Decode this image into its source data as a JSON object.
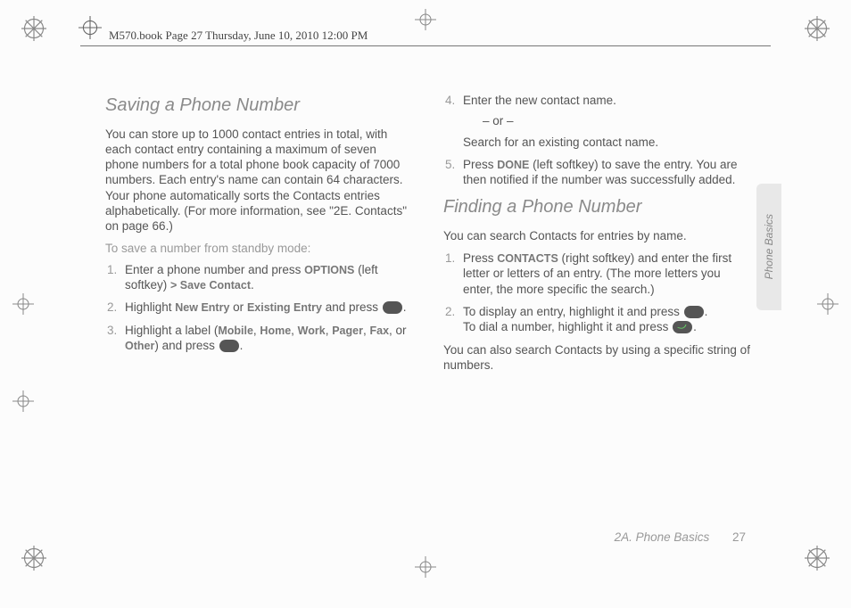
{
  "header": {
    "stamp": "M570.book  Page 27  Thursday, June 10, 2010  12:00 PM"
  },
  "sideTab": "Phone Basics",
  "footer": {
    "section": "2A. Phone Basics",
    "page": "27"
  },
  "s1": {
    "title": "Saving a Phone Number",
    "intro": "You can store up to 1000 contact entries in total, with each contact entry containing a maximum of seven phone numbers for a total phone book capacity of 7000 numbers. Each entry's name can contain 64 characters. Your phone automatically sorts the Contacts entries alphabetically. (For more information, see \"2E. Contacts\" on page 66.)",
    "sub": "To save a number from standby mode:",
    "step1a": "Enter a phone number and press ",
    "step1_opt": "OPTIONS",
    "step1b": " (left softkey) ",
    "gt": ">",
    "step1_save": " Save Contact",
    "step2a": "Highlight ",
    "step2_new": "New Entry",
    "step2_or": " or ",
    "step2_ex": "Existing Entry",
    "step2b": " and press ",
    "step3a": "Highlight a label (",
    "lbl_m": "Mobile",
    "c1": ", ",
    "lbl_h": "Home",
    "c2": ", ",
    "lbl_w": "Work",
    "c3": ", ",
    "lbl_p": "Pager",
    "c4": ", ",
    "lbl_f": "Fax",
    "c5": ", or ",
    "lbl_o": "Other",
    "step3b": ") and press ",
    "step4": "Enter the new contact name.",
    "step4_or": "– or –",
    "step4_alt": "Search for an existing contact name.",
    "step5a": "Press ",
    "step5_done": "DONE",
    "step5b": " (left softkey) to save the entry. You are then notified if the number was successfully added."
  },
  "s2": {
    "title": "Finding a Phone Number",
    "intro": "You can search Contacts for entries by name.",
    "step1a": "Press ",
    "step1_con": "CONTACTS",
    "step1b": " (right softkey) and enter the first letter or letters of an entry. (The more letters you enter, the more specific the search.)",
    "step2a": "To display an entry, highlight it and press ",
    "step2b": "To dial a number, highlight it and press ",
    "outro": "You can also search Contacts by using a specific string of numbers."
  },
  "period": "."
}
